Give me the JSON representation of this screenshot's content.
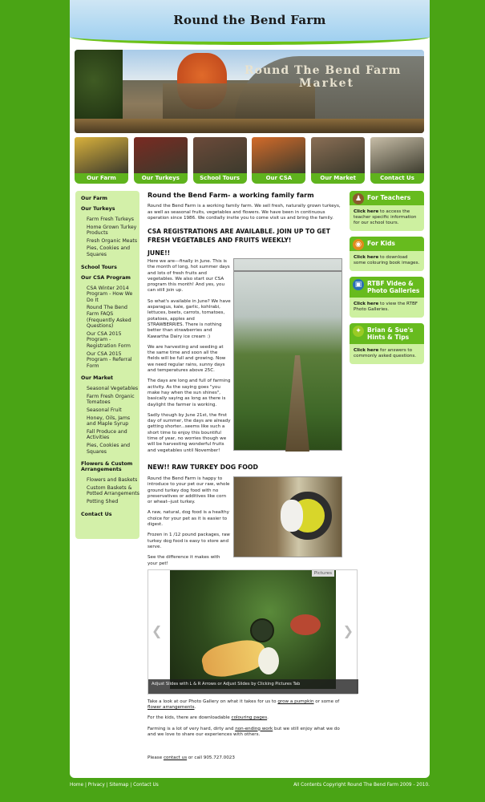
{
  "header": {
    "title": "Round the Bend Farm"
  },
  "banner": {
    "line1": "Round The Bend Farm",
    "line2": "Market"
  },
  "tiles": [
    {
      "label": "Our Farm",
      "color": "#d9b13c"
    },
    {
      "label": "Our Turkeys",
      "color": "#7a2a22"
    },
    {
      "label": "School Tours",
      "color": "#6c4a3a"
    },
    {
      "label": "Our CSA Program",
      "color": "#d36b2a"
    },
    {
      "label": "Our Market",
      "color": "#8a6e55"
    },
    {
      "label": "Contact Us",
      "color": "#c7bda7"
    }
  ],
  "sidebar": {
    "our_farm": "Our Farm",
    "our_turkeys": "Our Turkeys",
    "turkeys_links": [
      "Farm Fresh Turkeys",
      "Home Grown Turkey Products",
      "Fresh Organic Meats",
      "Pies, Cookies and Squares"
    ],
    "school_tours": "School Tours",
    "csa": "Our CSA Program",
    "csa_links": [
      "CSA Winter 2014 Program - How We Do It",
      "Round The Bend Farm FAQS (Frequently Asked Questions)",
      "Our CSA 2015 Program - Registration Form",
      "Our CSA 2015 Program - Referral Form"
    ],
    "market": "Our Market",
    "market_links": [
      "Seasonal Vegetables",
      "Farm Fresh Organic Tomatoes",
      "Seasonal Fruit",
      "Honey, Oils, Jams and Maple Syrup",
      "Fall Produce and Activities",
      "Pies, Cookies and Squares"
    ],
    "flowers": "Flowers & Custom Arrangements",
    "flowers_links": [
      "Flowers and Baskets",
      "Custom Baskets & Potted Arrangements",
      "Potting Shed"
    ],
    "contact": "Contact Us"
  },
  "main": {
    "heading": "Round the Bend Farm- a working family farm",
    "intro": "Round the Bend Farm is a working family farm. We sell fresh, naturally grown turkeys, as well as seasonal fruits, vegetables  and flowers. We have been in continuous operation since 1986. We cordially invite you to come visit us and bring the family.",
    "csa_heading": "CSA REGISTRATIONS ARE AVAILABLE. JOIN UP TO GET FRESH VEGETABLES AND FRUITS WEEKLY!",
    "june_heading": "JUNE!!",
    "june_paragraphs": [
      "Here we are---finally in June.  This is the month of long, hot summer days and lots of fresh fruits and vegetables.  We also start our CSA program this month!  And yes, you can still join up.",
      "So what's available in June?  We have asparagus, kale, garlic, kohlrabi, lettuces, beets, carrots, tomatoes, potatoes, apples and STRAWBERRIES.  There is nothing better than strawberries and Kawartha Dairy ice cream :)",
      "We are harvesting and seeding at the same time and soon all the fields will be full and growing.  Now we need regular rains, sunny days and temperatures above 25C.",
      "The days are long and full of farming activity.  As the saying goes \"you make hay when the sun shines\", basically saying as long as there is daylight the farmer is working.",
      "Sadly though by June 21st, the first day of summer, the days are already getting shorter...seems like such a short time to enjoy this bountiful time of year, no worries though we will be harvesting wonderful fruits and vegetables until November!"
    ],
    "dog_heading": "NEW!! RAW TURKEY DOG FOOD",
    "dog_paragraphs": [
      "Round the Bend Farm is happy to introduce to your pet our raw, whole ground turkey dog food with no preservatives or additives like corn or wheat--just turkey.",
      "A raw, natural, dog food is a healthy choice for your pet as it is easier to digest.",
      "Frozen in 1 /12 pound packages, raw turkey dog food is easy to store and serve.",
      "See the difference it makes with your pet!"
    ],
    "slideshow": {
      "tab": "Pictures",
      "caption": "Adjust Slides with L & R Arrows or Adjust Slides by Clicking Pictures Tab",
      "prev_icon": "chevron-left-icon",
      "next_icon": "chevron-right-icon"
    },
    "closing": {
      "p1_a": "Take a look at our Photo Gallery on what it takes for us to ",
      "p1_link1": "grow a pumpkin",
      "p1_b": " or some of ",
      "p1_link2": "flower arrangements",
      "p1_c": ".",
      "p2_a": "For the kids, there are downloadable ",
      "p2_link": "colouring pages",
      "p2_b": ".",
      "p3_a": "Farming is a lot of very hard, dirty and ",
      "p3_link": "non-ending work",
      "p3_b": " but we still enjoy what we do and we love to share our experiences with others.",
      "p4_a": "Please ",
      "p4_link": "contact us",
      "p4_b": " or call 905.727.0023"
    }
  },
  "right": [
    {
      "title": "For Teachers",
      "icon": "teacher-icon",
      "link": "Click here",
      "text": " to access the teacher specific information for our school tours."
    },
    {
      "title": "For Kids",
      "icon": "globe-icon",
      "link": "Click here",
      "text": " to download some colouring book images."
    },
    {
      "title": "RTBF Video & Photo Galleries",
      "icon": "video-icon",
      "link": "Click here",
      "text": " to view the RTBF Photo Galleries."
    },
    {
      "title": "Brian & Sue's Hints & Tips",
      "icon": "lightbulb-icon",
      "link": "Click here",
      "text": " for answers to commonly asked questions."
    }
  ],
  "footer": {
    "links": [
      "Home",
      "Privacy",
      "Sitemap",
      "Contact Us"
    ],
    "copyright": "All Contents Copyright Round The Bend Farm 2009 - 2010."
  }
}
